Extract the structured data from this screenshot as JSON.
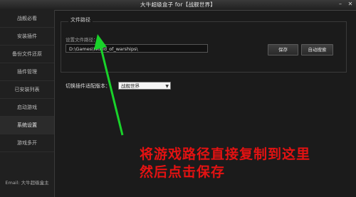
{
  "window": {
    "title": "大牛超级盒子 for【战舰世界】",
    "controls": [
      "–",
      "✕"
    ]
  },
  "sidebar": {
    "items": [
      {
        "label": "战舰必看"
      },
      {
        "label": "安装插件"
      },
      {
        "label": "备份文件还原"
      },
      {
        "label": "插件管理"
      },
      {
        "label": "已安装列表"
      },
      {
        "label": "启动游戏"
      },
      {
        "label": "系统设置"
      },
      {
        "label": "游戏多开"
      }
    ],
    "active_index": 6,
    "footer": "Email: 大牛超级盒主"
  },
  "settings": {
    "section_title": "文件路径",
    "field_label": "设置文件路径：",
    "path_value": "D:\\Games\\World_of_warships\\",
    "save_button": "保存",
    "auto_search_button": "自动搜索",
    "switch_label": "切换插件适配版本：",
    "version_selected": "战舰世界"
  },
  "annotation": {
    "line1": "将游戏路径直接复制到这里",
    "line2": "然后点击保存"
  },
  "colors": {
    "arrow": "#19d22a",
    "annotation_text": "#e31212",
    "background": "#1b1b1b"
  }
}
